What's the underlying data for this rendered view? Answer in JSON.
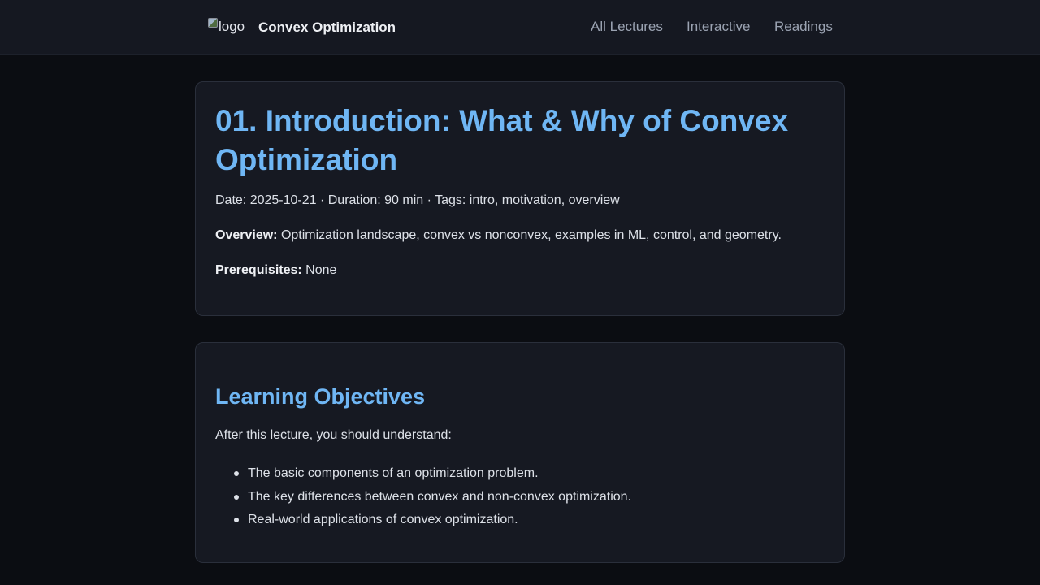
{
  "header": {
    "logo_alt": "logo",
    "site_title": "Convex Optimization",
    "nav": [
      "All Lectures",
      "Interactive",
      "Readings"
    ]
  },
  "lecture": {
    "title": "01. Introduction: What & Why of Convex Optimization",
    "meta": "Date: 2025-10-21 · Duration: 90 min · Tags: intro, motivation, overview",
    "overview_label": "Overview:",
    "overview_text": "Optimization landscape, convex vs nonconvex, examples in ML, control, and geometry.",
    "prereq_label": "Prerequisites:",
    "prereq_text": "None"
  },
  "objectives": {
    "heading": "Learning Objectives",
    "intro": "After this lecture, you should understand:",
    "items": [
      "The basic components of an optimization problem.",
      "The key differences between convex and non-convex optimization.",
      "Real-world applications of convex optimization."
    ]
  },
  "colors": {
    "background": "#0b0d12",
    "header": "#151821",
    "card": "#161922",
    "accent": "#6fb6f4",
    "nav_text": "#9ba3b2"
  }
}
